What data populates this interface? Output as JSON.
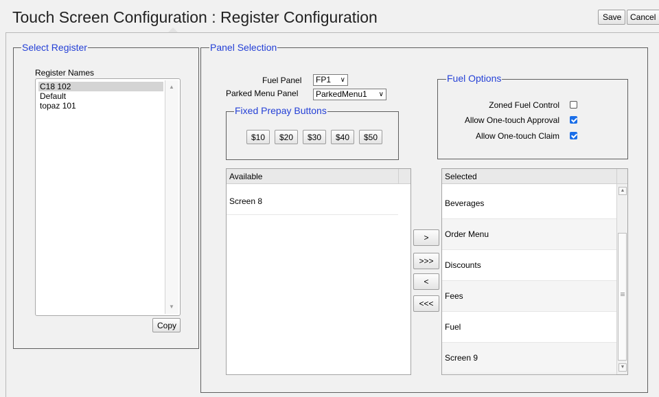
{
  "header": {
    "title": "Touch Screen Configuration : Register Configuration",
    "save_label": "Save",
    "cancel_label": "Cancel"
  },
  "select_register": {
    "legend": "Select Register",
    "list_label": "Register Names",
    "items": [
      "C18 102",
      "Default",
      "topaz 101"
    ],
    "selected": "C18 102",
    "copy_label": "Copy"
  },
  "panel_selection": {
    "legend": "Panel Selection",
    "fuel_panel_label": "Fuel Panel",
    "fuel_panel_value": "FP1",
    "parked_menu_label": "Parked Menu Panel",
    "parked_menu_value": "ParkedMenu1",
    "fixed_prepay": {
      "legend": "Fixed Prepay Buttons",
      "buttons": [
        "$10",
        "$20",
        "$30",
        "$40",
        "$50"
      ]
    },
    "fuel_options": {
      "legend": "Fuel Options",
      "options": [
        {
          "label": "Zoned Fuel Control",
          "checked": false
        },
        {
          "label": "Allow One-touch Approval",
          "checked": true
        },
        {
          "label": "Allow One-touch Claim",
          "checked": true
        }
      ]
    },
    "available": {
      "header": "Available",
      "items": [
        "Screen 8"
      ]
    },
    "transfer_buttons": {
      "add": ">",
      "add_all": ">>>",
      "remove": "<",
      "remove_all": "<<<"
    },
    "selected": {
      "header": "Selected",
      "items": [
        "Beverages",
        "Order Menu",
        "Discounts",
        "Fees",
        "Fuel",
        "Screen 9"
      ]
    }
  },
  "colors": {
    "legend_text": "#2440d6",
    "checkbox_checked": "#1a6ee8",
    "list_selection": "#d4d4d4",
    "page_background": "#f1f1f1"
  }
}
